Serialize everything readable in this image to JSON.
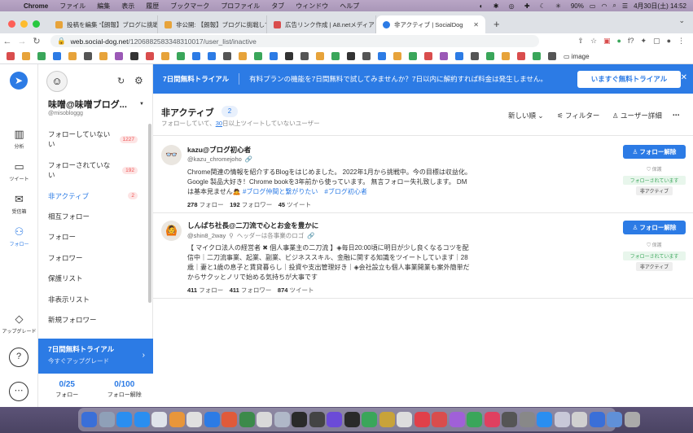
{
  "menubar": {
    "app": "Chrome",
    "items": [
      "ファイル",
      "編集",
      "表示",
      "履歴",
      "ブックマーク",
      "プロファイル",
      "タブ",
      "ウィンドウ",
      "ヘルプ"
    ],
    "battery": "90%",
    "datetime": "4月30日(土) 14:52"
  },
  "tabs": [
    {
      "label": "投稿を編集 “【朗報】ブログに挑戦…",
      "color": "#e7a33a"
    },
    {
      "label": "非公開: 【朗報】ブログに挑戦して",
      "color": "#e7a33a"
    },
    {
      "label": "広告リンク作成 | A8.netメディア",
      "color": "#d94d4d"
    },
    {
      "label": "非アクティブ | SocialDog",
      "color": "#2c7be5"
    }
  ],
  "address": {
    "host": "web.social-dog.net",
    "path": "/1206882583348310017/user_list/inactive"
  },
  "bookmarks": {
    "folder_label": "image",
    "icons": [
      "#d94d4d",
      "#e7a33a",
      "#3aa65a",
      "#2c7be5",
      "#e7a33a",
      "#555",
      "#e7a33a",
      "#9b59b6",
      "#333",
      "#d94d4d",
      "#e7a33a",
      "#3aa65a",
      "#2c7be5",
      "#2c7be5",
      "#555",
      "#e7a33a",
      "#3aa65a",
      "#2c7be5",
      "#333",
      "#555",
      "#e7a33a",
      "#3aa65a",
      "#333",
      "#555",
      "#2c7be5",
      "#e7a33a",
      "#3aa65a",
      "#d94d4d",
      "#9b59b6",
      "#2c7be5",
      "#555",
      "#3aa65a",
      "#e7a33a",
      "#d94d4d",
      "#3aa65a",
      "#555"
    ]
  },
  "rail": {
    "analytics": "分析",
    "tweet": "ツイート",
    "inbox": "受信箱",
    "follow": "フォロー",
    "upgrade": "アップグレード"
  },
  "sidebar": {
    "account_name": "味噌@味噌ブログ...",
    "account_handle": "@misobloggg",
    "items": [
      {
        "label": "フォローしていない",
        "label2": "い",
        "badge": "1227"
      },
      {
        "label": "フォローされていな",
        "label2": "い",
        "badge": "192"
      },
      {
        "label": "非アクティブ",
        "badge": "2"
      },
      {
        "label": "相互フォロー"
      },
      {
        "label": "フォロー"
      },
      {
        "label": "フォロワー"
      },
      {
        "label": "保護リスト"
      },
      {
        "label": "非表示リスト"
      },
      {
        "label": "新規フォロワー"
      }
    ],
    "trial_title": "7日間無料トライアル",
    "trial_sub": "今すぐアップグレード",
    "stats": [
      {
        "value": "0/25",
        "label": "フォロー"
      },
      {
        "value": "0/100",
        "label": "フォロー解除"
      }
    ]
  },
  "banner": {
    "title": "7日間無料トライアル",
    "body": "有料プランの機能を7日間無料で試してみませんか？7日以内に解約すれば料金は発生しません。",
    "cta": "いますぐ無料トライアル"
  },
  "page": {
    "title": "非アクティブ",
    "count": "2",
    "sub_pre": "フォローしていて、",
    "sub_days": "30",
    "sub_post": "日以上ツイートしていないユーザー",
    "sort": "新しい順",
    "filter": "フィルター",
    "detail": "ユーザー詳細"
  },
  "users": [
    {
      "name": "kazu@ブログ初心者",
      "handle": "@kazu_chromejoho",
      "ref": "",
      "bio": "Chrome関連の情報を紹介するBlogをはじめました。 2022年1月から挑戦中。今の目標は収益化。 Google 製品大好き！Chrome bookを3年前から使っています。 無言フォロー失礼致します。 DMは基本見ません🙇",
      "tags": "#ブログ仲間と繋がりたい　#ブログ初心者",
      "following": "278",
      "followers": "192",
      "tweets": "45",
      "button": "フォロー解除",
      "guard": "保護",
      "followed_by": "フォローされています",
      "status": "非アクティブ"
    },
    {
      "name": "しんぱち社長@二刀流で心とお金を豊かに",
      "handle": "@shin8_2way",
      "ref": "ヘッダーは各事業のロゴ",
      "bio": "【 マイクロ法人の経営者 ✖ 個人事業主の二刀流 】◈毎日20:00頃に明日が少し良くなるコツを配信中｜二刀流事業、起業、副業、ビジネススキル、金融に関する知識をツイートしています｜28歳｜妻と1歳の息子と賃貸暮らし｜投資や支出管理好き｜◈会社設立も個人事業開業も案外簡単だからサクッとノリで始める気持ちが大事です",
      "tags": "",
      "following": "411",
      "followers": "411",
      "tweets": "874",
      "button": "フォロー解除",
      "guard": "保護",
      "followed_by": "フォローされています",
      "status": "非アクティブ"
    }
  ],
  "labels": {
    "following": "フォロー",
    "followers": "フォロワー",
    "tweets": "ツイート"
  },
  "dock": [
    "#3a6fd8",
    "#8fa0b8",
    "#2a8ef0",
    "#2a8ef0",
    "#dfe3ea",
    "#e8963a",
    "#e0e0e0",
    "#2c7be5",
    "#e05a3a",
    "#3c8a4a",
    "#d9d9d9",
    "#b0b8c8",
    "#2a2a2a",
    "#444",
    "#6b4bd8",
    "#2a2a2a",
    "#3aa65a",
    "#c8a33a",
    "#ddd",
    "#e0404a",
    "#d94d4d",
    "#a060d8",
    "#3aa65a",
    "#e04060",
    "#555",
    "#888",
    "#2a8ef0",
    "#c8c8d8",
    "#d0d0d0",
    "#3a6fd8",
    "#6090d8",
    "#aaa"
  ]
}
